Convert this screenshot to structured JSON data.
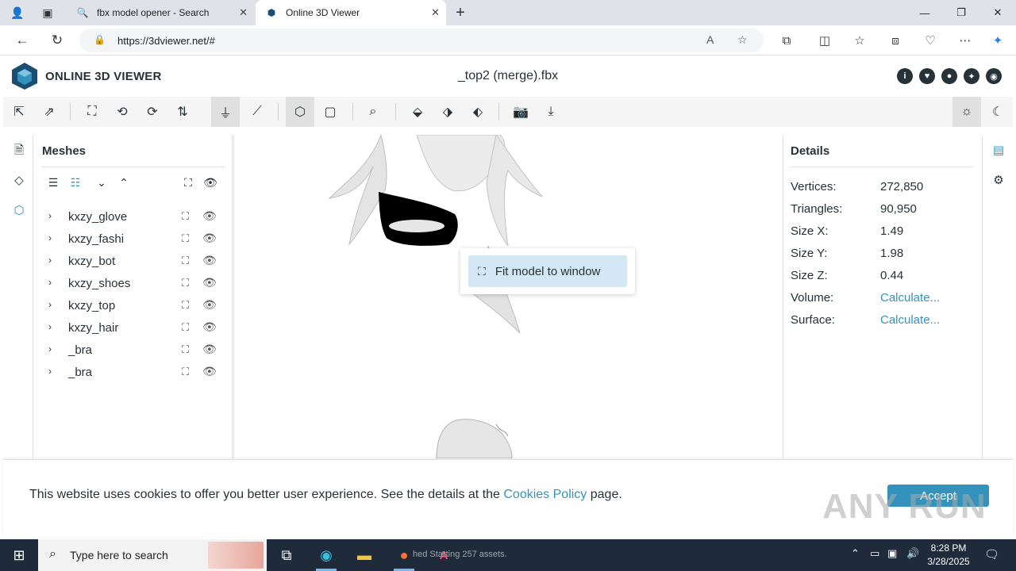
{
  "browser": {
    "tabs": [
      {
        "title": "fbx model opener - Search",
        "close": "✕"
      },
      {
        "title": "Online 3D Viewer",
        "close": "✕"
      }
    ],
    "new_tab": "+",
    "window": {
      "minimize": "—",
      "maximize": "❐",
      "close": "✕"
    },
    "url": "https://3dviewer.net/#"
  },
  "app": {
    "logo_text": "ONLINE 3D VIEWER",
    "file_title": "_top2 (merge).fbx",
    "brand_color": "#3393bd"
  },
  "meshes": {
    "title": "Meshes",
    "items": [
      {
        "name": "kxzy_glove"
      },
      {
        "name": "kxzy_fashi"
      },
      {
        "name": "kxzy_bot"
      },
      {
        "name": "kxzy_shoes"
      },
      {
        "name": "kxzy_top"
      },
      {
        "name": "kxzy_hair"
      },
      {
        "name": "_bra"
      },
      {
        "name": "_bra"
      }
    ]
  },
  "viewport": {
    "popup_label": "Fit model to window"
  },
  "details": {
    "title": "Details",
    "rows": [
      {
        "key": "Vertices:",
        "value": "272,850"
      },
      {
        "key": "Triangles:",
        "value": "90,950"
      },
      {
        "key": "Size X:",
        "value": "1.49"
      },
      {
        "key": "Size Y:",
        "value": "1.98"
      },
      {
        "key": "Size Z:",
        "value": "0.44"
      },
      {
        "key": "Volume:",
        "value": "Calculate..."
      },
      {
        "key": "Surface:",
        "value": "Calculate..."
      }
    ]
  },
  "cookie": {
    "text_before": "This website uses cookies to offer you better user experience. See the details at the ",
    "link": "Cookies Policy",
    "text_after": " page.",
    "accept": "Accept",
    "watermark": "ANY RUN"
  },
  "taskbar": {
    "search_placeholder": "Type here to search",
    "task_text": "hed  Starting 257 assets.",
    "time": "8:28 PM",
    "date": "3/28/2025"
  }
}
